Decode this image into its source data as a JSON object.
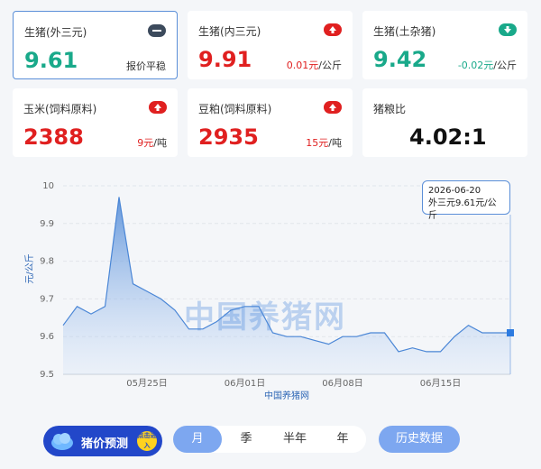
{
  "cards": [
    {
      "title": "生猪(外三元)",
      "value": "9.61",
      "change": "报价平稳",
      "trend": "flat",
      "value_color": "#19a98a"
    },
    {
      "title": "生猪(内三元)",
      "value": "9.91",
      "change_value": "0.01元",
      "change_unit": "/公斤",
      "trend": "up",
      "value_color": "#e02020"
    },
    {
      "title": "生猪(土杂猪)",
      "value": "9.42",
      "change_value": "-0.02元",
      "change_unit": "/公斤",
      "trend": "down",
      "value_color": "#19a98a"
    },
    {
      "title": "玉米(饲料原料)",
      "value": "2388",
      "change_value": "9元",
      "change_unit": "/吨",
      "trend": "up",
      "value_color": "#e02020"
    },
    {
      "title": "豆粕(饲料原料)",
      "value": "2935",
      "change_value": "15元",
      "change_unit": "/吨",
      "trend": "up",
      "value_color": "#e02020"
    },
    {
      "title": "猪粮比",
      "value": "4.02:1",
      "value_color": "#111111"
    }
  ],
  "chart_data": {
    "type": "area",
    "x": [
      "05-19",
      "05-20",
      "05-21",
      "05-22",
      "05-23",
      "05-24",
      "05-25",
      "05-26",
      "05-27",
      "05-28",
      "05-29",
      "05-30",
      "05-31",
      "06-01",
      "06-02",
      "06-03",
      "06-04",
      "06-05",
      "06-06",
      "06-07",
      "06-08",
      "06-09",
      "06-10",
      "06-11",
      "06-12",
      "06-13",
      "06-14",
      "06-15",
      "06-16",
      "06-17",
      "06-18",
      "06-19",
      "06-20"
    ],
    "values": [
      9.63,
      9.68,
      9.66,
      9.68,
      9.97,
      9.74,
      9.72,
      9.7,
      9.67,
      9.62,
      9.62,
      9.64,
      9.67,
      9.68,
      9.68,
      9.61,
      9.6,
      9.6,
      9.59,
      9.58,
      9.6,
      9.6,
      9.61,
      9.61,
      9.56,
      9.57,
      9.56,
      9.56,
      9.6,
      9.63,
      9.61,
      9.61,
      9.61
    ],
    "xticks": [
      {
        "x": "05-25",
        "label": "05月25日"
      },
      {
        "x": "06-01",
        "label": "06月01日"
      },
      {
        "x": "06-08",
        "label": "06月08日"
      },
      {
        "x": "06-15",
        "label": "06月15日"
      }
    ],
    "yticks": [
      "9.5",
      "9.6",
      "9.7",
      "9.8",
      "9.9",
      "10"
    ],
    "ylim": [
      9.5,
      10
    ],
    "ylabel": "元/公斤",
    "xlabel": "中国养猪网",
    "grid": true,
    "line_color": "#4a86d6",
    "area_color": "#6fa2e6"
  },
  "tooltip": {
    "date": "2026-06-20",
    "text": "外三元9.61元/公斤"
  },
  "watermark": "中国养猪网",
  "predict_label": "猪价预测",
  "predict_badge": "点击进入",
  "tabs": [
    {
      "label": "月",
      "active": true
    },
    {
      "label": "季"
    },
    {
      "label": "半年"
    },
    {
      "label": "年"
    }
  ],
  "history_label": "历史数据"
}
